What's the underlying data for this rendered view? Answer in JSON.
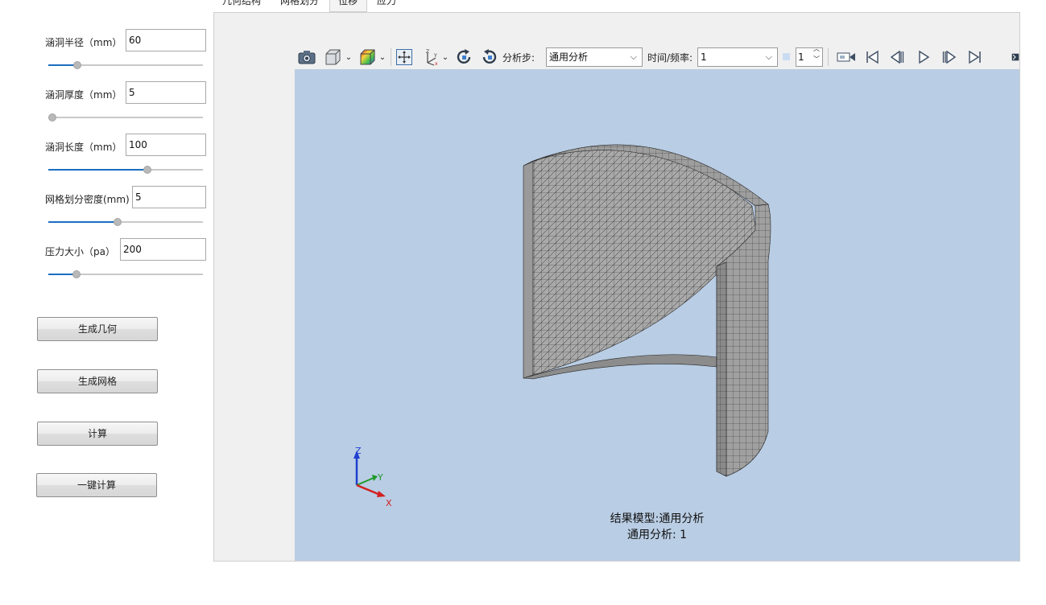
{
  "tabs": [
    {
      "label": "几何结构"
    },
    {
      "label": "网格划分"
    },
    {
      "label": "位移"
    },
    {
      "label": "应力"
    }
  ],
  "params": [
    {
      "label": "涵洞半径（mm）",
      "value": "60",
      "slider_fraction": 0.19
    },
    {
      "label": "涵洞厚度（mm）",
      "value": "5",
      "slider_fraction": 0.0
    },
    {
      "label": "涵洞长度（mm）",
      "value": "100",
      "slider_fraction": 0.64
    },
    {
      "label": "网格划分密度(mm)",
      "value": "5",
      "slider_fraction": 0.45
    },
    {
      "label": "压力大小（pa）",
      "value": "200",
      "slider_fraction": 0.18
    }
  ],
  "buttons": {
    "gen_geometry": "生成几何",
    "gen_mesh": "生成网格",
    "compute": "计算",
    "one_click": "一键计算"
  },
  "toolbar": {
    "step_label": "分析步:",
    "step_value": "通用分析",
    "time_label": "时间/频率:",
    "time_value": "1",
    "frame_value": "1"
  },
  "viewport": {
    "result_model": "结果模型:通用分析",
    "result_step": "通用分析: 1",
    "axis_x": "X",
    "axis_y": "Y",
    "axis_z": "Z",
    "background_color": "#b9cde4"
  }
}
